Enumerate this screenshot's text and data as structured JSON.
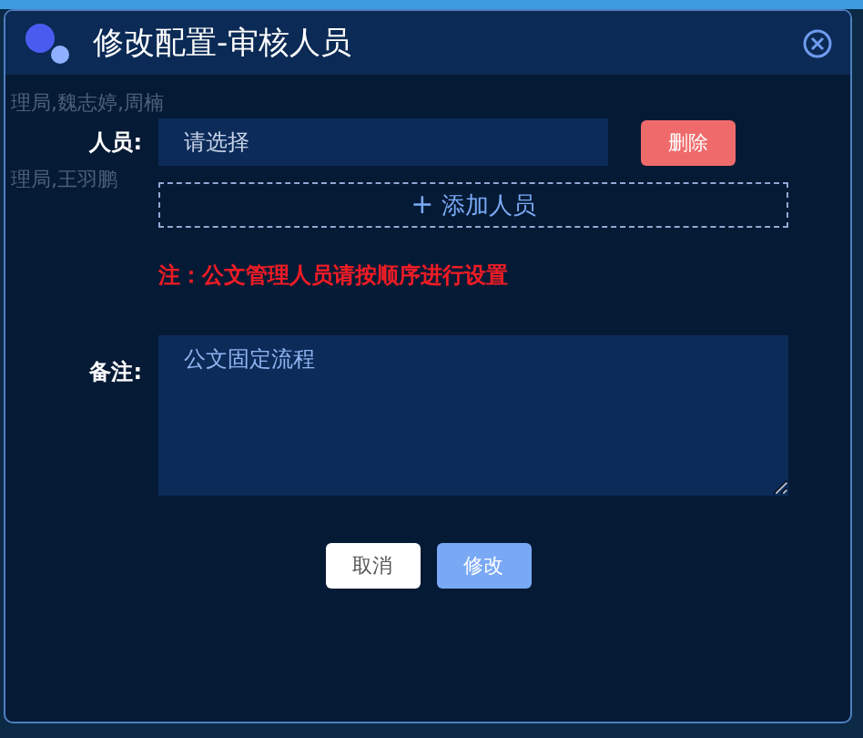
{
  "dialog": {
    "title": "修改配置-审核人员"
  },
  "background_texts": [
    "理局,魏志婷,周楠",
    "理局,王羽鹏"
  ],
  "form": {
    "person_label": "人员:",
    "person_select": {
      "placeholder": "请选择"
    },
    "delete_button": "删除",
    "add_button": {
      "icon": "+",
      "label": "添加人员"
    },
    "note": "注：公文管理人员请按顺序进行设置",
    "remark_label": "备注:",
    "remark_value": "公文固定流程"
  },
  "buttons": [
    {
      "label": "取消",
      "kind": "default"
    },
    {
      "label": "修改",
      "kind": "primary"
    }
  ]
}
